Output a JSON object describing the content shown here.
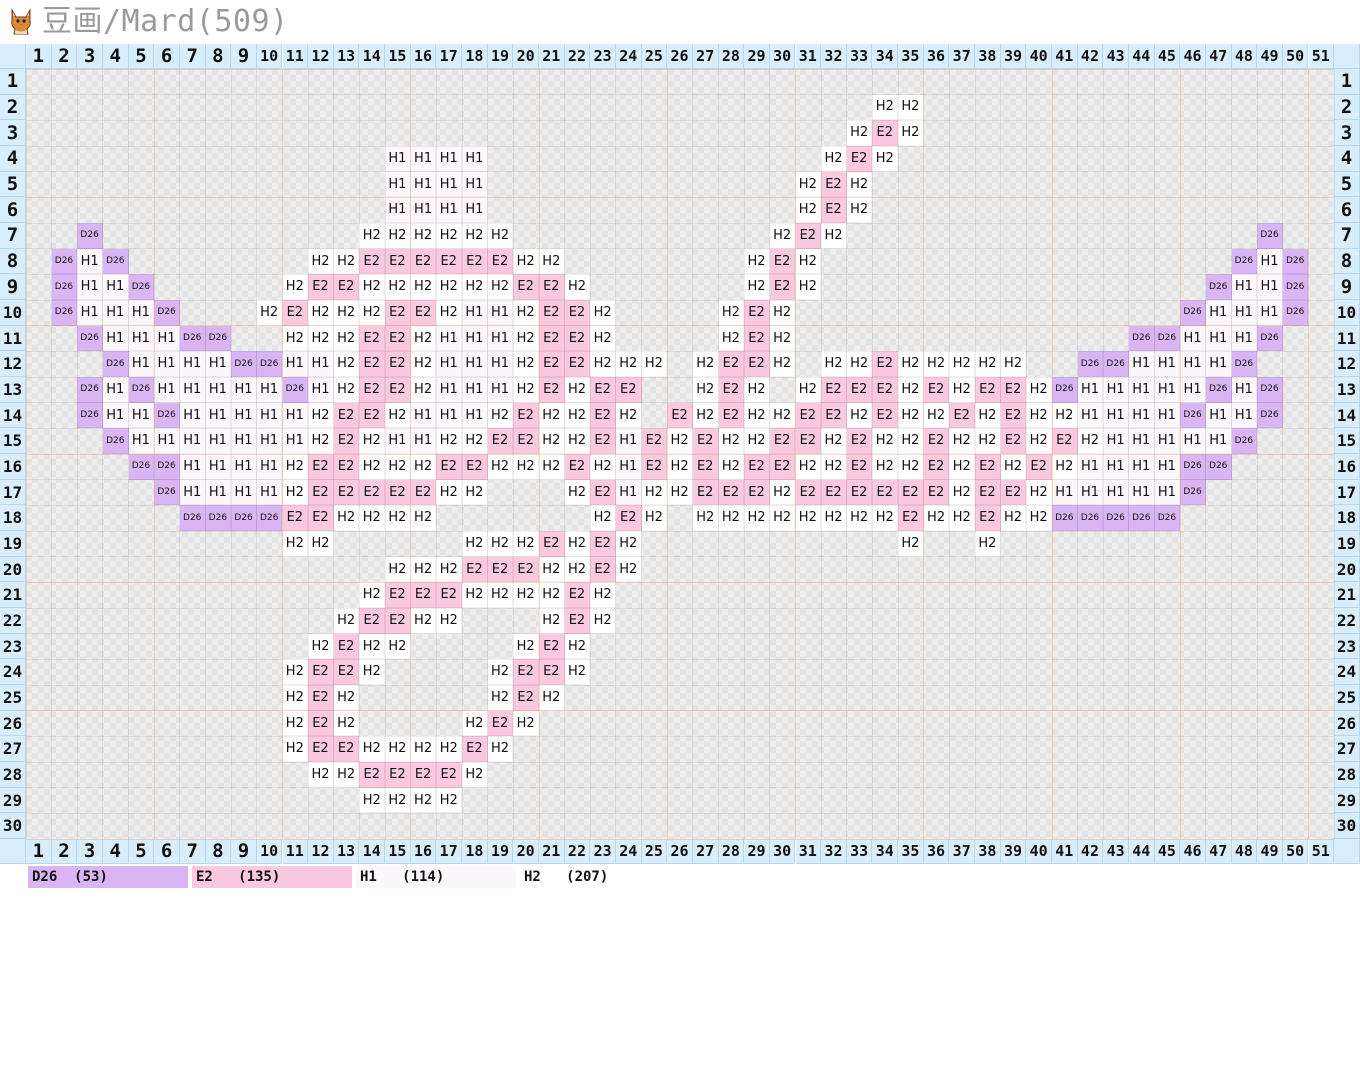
{
  "title": "豆画/Mard(509)",
  "logo_icon": "cat-icon",
  "grid": {
    "cols": 51,
    "rows": 30,
    "colors": {
      "D26": "#d9b6f3",
      "E2": "#fac9df",
      "H1": "#fbf7fb",
      "H2": "#ffffff"
    },
    "cells": {
      "2": {
        "34": "H2",
        "35": "H2"
      },
      "3": {
        "33": "H2",
        "34": "E2",
        "35": "H2"
      },
      "4": {
        "15": "H1",
        "16": "H1",
        "17": "H1",
        "18": "H1",
        "32": "H2",
        "33": "E2",
        "34": "H2"
      },
      "5": {
        "15": "H1",
        "16": "H1",
        "17": "H1",
        "18": "H1",
        "31": "H2",
        "32": "E2",
        "33": "H2"
      },
      "6": {
        "15": "H1",
        "16": "H1",
        "17": "H1",
        "18": "H1",
        "31": "H2",
        "32": "E2",
        "33": "H2"
      },
      "7": {
        "3": "D26",
        "14": "H2",
        "15": "H2",
        "16": "H2",
        "17": "H2",
        "18": "H2",
        "19": "H2",
        "30": "H2",
        "31": "E2",
        "32": "H2",
        "49": "D26"
      },
      "8": {
        "2": "D26",
        "3": "H1",
        "4": "D26",
        "12": "H2",
        "13": "H2",
        "14": "E2",
        "15": "E2",
        "16": "E2",
        "17": "E2",
        "18": "E2",
        "19": "E2",
        "20": "H2",
        "21": "H2",
        "29": "H2",
        "30": "E2",
        "31": "H2",
        "48": "D26",
        "49": "H1",
        "50": "D26"
      },
      "9": {
        "2": "D26",
        "3": "H1",
        "4": "H1",
        "5": "D26",
        "11": "H2",
        "12": "E2",
        "13": "E2",
        "14": "H2",
        "15": "H2",
        "16": "H2",
        "17": "H2",
        "18": "H2",
        "19": "H2",
        "20": "E2",
        "21": "E2",
        "22": "H2",
        "29": "H2",
        "30": "E2",
        "31": "H2",
        "47": "D26",
        "48": "H1",
        "49": "H1",
        "50": "D26"
      },
      "10": {
        "2": "D26",
        "3": "H1",
        "4": "H1",
        "5": "H1",
        "6": "D26",
        "10": "H2",
        "11": "E2",
        "12": "H2",
        "13": "H2",
        "14": "H2",
        "15": "E2",
        "16": "E2",
        "17": "H2",
        "18": "H1",
        "19": "H1",
        "20": "H2",
        "21": "E2",
        "22": "E2",
        "23": "H2",
        "28": "H2",
        "29": "E2",
        "30": "H2",
        "46": "D26",
        "47": "H1",
        "48": "H1",
        "49": "H1",
        "50": "D26"
      },
      "11": {
        "3": "D26",
        "4": "H1",
        "5": "H1",
        "6": "H1",
        "7": "D26",
        "8": "D26",
        "11": "H2",
        "12": "H2",
        "13": "H2",
        "14": "E2",
        "15": "E2",
        "16": "H2",
        "17": "H1",
        "18": "H1",
        "19": "H1",
        "20": "H2",
        "21": "E2",
        "22": "E2",
        "23": "H2",
        "28": "H2",
        "29": "E2",
        "30": "H2",
        "44": "D26",
        "45": "D26",
        "46": "H1",
        "47": "H1",
        "48": "H1",
        "49": "D26"
      },
      "12": {
        "4": "D26",
        "5": "H1",
        "6": "H1",
        "7": "H1",
        "8": "H1",
        "9": "D26",
        "10": "D26",
        "11": "H1",
        "12": "H1",
        "13": "H2",
        "14": "E2",
        "15": "E2",
        "16": "H2",
        "17": "H1",
        "18": "H1",
        "19": "H1",
        "20": "H2",
        "21": "E2",
        "22": "E2",
        "23": "H2",
        "24": "H2",
        "25": "H2",
        "27": "H2",
        "28": "E2",
        "29": "E2",
        "30": "H2",
        "32": "H2",
        "33": "H2",
        "34": "E2",
        "35": "H2",
        "36": "H2",
        "37": "H2",
        "38": "H2",
        "39": "H2",
        "42": "D26",
        "43": "D26",
        "44": "H1",
        "45": "H1",
        "46": "H1",
        "47": "H1",
        "48": "D26"
      },
      "13": {
        "3": "D26",
        "4": "H1",
        "5": "D26",
        "6": "H1",
        "7": "H1",
        "8": "H1",
        "9": "H1",
        "10": "H1",
        "11": "D26",
        "12": "H1",
        "13": "H2",
        "14": "E2",
        "15": "E2",
        "16": "H2",
        "17": "H1",
        "18": "H1",
        "19": "H1",
        "20": "H2",
        "21": "E2",
        "22": "H2",
        "23": "E2",
        "24": "E2",
        "27": "H2",
        "28": "E2",
        "29": "H2",
        "31": "H2",
        "32": "E2",
        "33": "E2",
        "34": "E2",
        "35": "H2",
        "36": "E2",
        "37": "H2",
        "38": "E2",
        "39": "E2",
        "40": "H2",
        "41": "D26",
        "42": "H1",
        "43": "H1",
        "44": "H1",
        "45": "H1",
        "46": "H1",
        "47": "D26",
        "48": "H1",
        "49": "D26"
      },
      "14": {
        "3": "D26",
        "4": "H1",
        "5": "H1",
        "6": "D26",
        "7": "H1",
        "8": "H1",
        "9": "H1",
        "10": "H1",
        "11": "H1",
        "12": "H2",
        "13": "E2",
        "14": "E2",
        "15": "H2",
        "16": "H1",
        "17": "H1",
        "18": "H1",
        "19": "H2",
        "20": "E2",
        "21": "H2",
        "22": "H2",
        "23": "E2",
        "24": "H2",
        "26": "E2",
        "27": "H2",
        "28": "E2",
        "29": "H2",
        "30": "H2",
        "31": "E2",
        "32": "E2",
        "33": "H2",
        "34": "E2",
        "35": "H2",
        "36": "H2",
        "37": "E2",
        "38": "H2",
        "39": "E2",
        "40": "H2",
        "41": "H2",
        "42": "H1",
        "43": "H1",
        "44": "H1",
        "45": "H1",
        "46": "D26",
        "47": "H1",
        "48": "H1",
        "49": "D26"
      },
      "15": {
        "4": "D26",
        "5": "H1",
        "6": "H1",
        "7": "H1",
        "8": "H1",
        "9": "H1",
        "10": "H1",
        "11": "H1",
        "12": "H2",
        "13": "E2",
        "14": "H2",
        "15": "H1",
        "16": "H1",
        "17": "H2",
        "18": "H2",
        "19": "E2",
        "20": "E2",
        "21": "H2",
        "22": "H2",
        "23": "E2",
        "24": "H1",
        "25": "E2",
        "26": "H2",
        "27": "E2",
        "28": "H2",
        "29": "H2",
        "30": "E2",
        "31": "E2",
        "32": "H2",
        "33": "E2",
        "34": "H2",
        "35": "H2",
        "36": "E2",
        "37": "H2",
        "38": "H2",
        "39": "E2",
        "40": "H2",
        "41": "E2",
        "42": "H2",
        "43": "H1",
        "44": "H1",
        "45": "H1",
        "46": "H1",
        "47": "H1",
        "48": "D26"
      },
      "16": {
        "5": "D26",
        "6": "D26",
        "7": "H1",
        "8": "H1",
        "9": "H1",
        "10": "H1",
        "11": "H2",
        "12": "E2",
        "13": "E2",
        "14": "H2",
        "15": "H2",
        "16": "H2",
        "17": "E2",
        "18": "E2",
        "19": "H2",
        "20": "H2",
        "21": "H2",
        "22": "E2",
        "23": "H2",
        "24": "H1",
        "25": "E2",
        "26": "H2",
        "27": "E2",
        "28": "H2",
        "29": "E2",
        "30": "E2",
        "31": "H2",
        "32": "H2",
        "33": "E2",
        "34": "H2",
        "35": "H2",
        "36": "E2",
        "37": "H2",
        "38": "E2",
        "39": "H2",
        "40": "E2",
        "41": "H2",
        "42": "H1",
        "43": "H1",
        "44": "H1",
        "45": "H1",
        "46": "D26",
        "47": "D26"
      },
      "17": {
        "6": "D26",
        "7": "H1",
        "8": "H1",
        "9": "H1",
        "10": "H1",
        "11": "H2",
        "12": "E2",
        "13": "E2",
        "14": "E2",
        "15": "E2",
        "16": "E2",
        "17": "H2",
        "18": "H2",
        "22": "H2",
        "23": "E2",
        "24": "H1",
        "25": "H2",
        "26": "H2",
        "27": "E2",
        "28": "E2",
        "29": "E2",
        "30": "H2",
        "31": "E2",
        "32": "E2",
        "33": "E2",
        "34": "E2",
        "35": "E2",
        "36": "E2",
        "37": "H2",
        "38": "E2",
        "39": "E2",
        "40": "H2",
        "41": "H1",
        "42": "H1",
        "43": "H1",
        "44": "H1",
        "45": "H1",
        "46": "D26"
      },
      "18": {
        "7": "D26",
        "8": "D26",
        "9": "D26",
        "10": "D26",
        "11": "E2",
        "12": "E2",
        "13": "H2",
        "14": "H2",
        "15": "H2",
        "16": "H2",
        "23": "H2",
        "24": "E2",
        "25": "H2",
        "27": "H2",
        "28": "H2",
        "29": "H2",
        "30": "H2",
        "31": "H2",
        "32": "H2",
        "33": "H2",
        "34": "H2",
        "35": "E2",
        "36": "H2",
        "37": "H2",
        "38": "E2",
        "39": "H2",
        "40": "H2",
        "41": "D26",
        "42": "D26",
        "43": "D26",
        "44": "D26",
        "45": "D26"
      },
      "19": {
        "11": "H2",
        "12": "H2",
        "18": "H2",
        "19": "H2",
        "20": "H2",
        "21": "E2",
        "22": "H2",
        "23": "E2",
        "24": "H2",
        "35": "H2",
        "38": "H2"
      },
      "20": {
        "15": "H2",
        "16": "H2",
        "17": "H2",
        "18": "E2",
        "19": "E2",
        "20": "E2",
        "21": "H2",
        "22": "H2",
        "23": "E2",
        "24": "H2"
      },
      "21": {
        "14": "H2",
        "15": "E2",
        "16": "E2",
        "17": "E2",
        "18": "H2",
        "19": "H2",
        "20": "H2",
        "21": "H2",
        "22": "E2",
        "23": "H2"
      },
      "22": {
        "13": "H2",
        "14": "E2",
        "15": "E2",
        "16": "H2",
        "17": "H2",
        "21": "H2",
        "22": "E2",
        "23": "H2"
      },
      "23": {
        "12": "H2",
        "13": "E2",
        "14": "H2",
        "15": "H2",
        "20": "H2",
        "21": "E2",
        "22": "H2"
      },
      "24": {
        "11": "H2",
        "12": "E2",
        "13": "E2",
        "14": "H2",
        "19": "H2",
        "20": "E2",
        "21": "E2",
        "22": "H2"
      },
      "25": {
        "11": "H2",
        "12": "E2",
        "13": "H2",
        "19": "H2",
        "20": "E2",
        "21": "H2"
      },
      "26": {
        "11": "H2",
        "12": "E2",
        "13": "H2",
        "18": "H2",
        "19": "E2",
        "20": "H2"
      },
      "27": {
        "11": "H2",
        "12": "E2",
        "13": "E2",
        "14": "H2",
        "15": "H2",
        "16": "H2",
        "17": "H2",
        "18": "E2",
        "19": "H2"
      },
      "28": {
        "12": "H2",
        "13": "H2",
        "14": "E2",
        "15": "E2",
        "16": "E2",
        "17": "E2",
        "18": "H2"
      },
      "29": {
        "14": "H2",
        "15": "H2",
        "16": "H2",
        "17": "H2"
      }
    }
  },
  "legend": [
    {
      "code": "D26",
      "text": "D26  (53)",
      "color": "#d9b6f3"
    },
    {
      "code": "E2",
      "text": "E2   (135)",
      "color": "#fac9df"
    },
    {
      "code": "H1",
      "text": "H1   (114)",
      "color": "#fbf7fb"
    },
    {
      "code": "H2",
      "text": "H2   (207)",
      "color": "#ffffff"
    }
  ]
}
